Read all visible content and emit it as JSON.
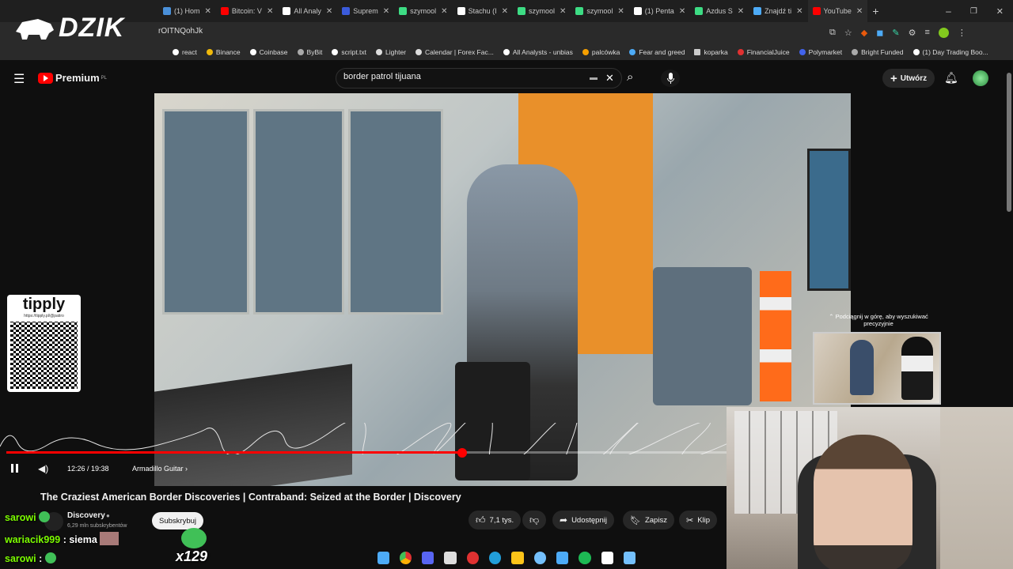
{
  "browser": {
    "tabs": [
      {
        "label": "(1) Hom",
        "color": "#4a90d9"
      },
      {
        "label": "Bitcoin: V",
        "color": "#ff0000"
      },
      {
        "label": "All Analy",
        "color": "#ffffff"
      },
      {
        "label": "Suprem",
        "color": "#3b5bdb"
      },
      {
        "label": "szymool",
        "color": "#3ddc84"
      },
      {
        "label": "Stachu (I",
        "color": "#ffffff"
      },
      {
        "label": "szymool",
        "color": "#3ddc84"
      },
      {
        "label": "szymool",
        "color": "#3ddc84"
      },
      {
        "label": "(1) Penta",
        "color": "#ffffff"
      },
      {
        "label": "Azdus S",
        "color": "#3ddc84"
      },
      {
        "label": "Znajdź ti",
        "color": "#4dabf7"
      },
      {
        "label": "YouTube",
        "color": "#ff0000"
      }
    ],
    "url_fragment": "rOITNQohJk",
    "bookmarks": [
      "react",
      "Binance",
      "Coinbase",
      "ByBit",
      "script.txt",
      "Lighter",
      "Calendar | Forex Fac...",
      "All Analysts - unbias",
      "palcówka",
      "Fear and greed",
      "koparka",
      "FinancialJuice",
      "Polymarket",
      "Bright Funded",
      "(1) Day Trading Boo..."
    ],
    "overlay_logo": "DZIK"
  },
  "youtube": {
    "logo": "Premium",
    "logo_sup": "PL",
    "search_value": "border patrol tijuana",
    "create_label": "Utwórz",
    "video": {
      "time": "12:26 / 19:38",
      "chapter": "Armadillo Guitar",
      "progress_pct": 63.3,
      "title": "The Craziest American Border Discoveries | Contraband: Seized at the Border | Discovery"
    },
    "channel": {
      "name": "Discovery",
      "subs": "6,29 mln subskrybentów",
      "subscribe": "Subskrybuj"
    },
    "actions": {
      "likes": "7,1 tys.",
      "share": "Udostępnij",
      "save": "Zapisz",
      "clip": "Klip"
    },
    "miniplayer_hint": "Podciągnij w górę, aby wyszukiwać precyzyjnie"
  },
  "stream_overlay": {
    "tipply_label": "tipply",
    "tipply_url": "https://tipply.pl/@patiro",
    "chat": [
      {
        "user": "sarowi",
        "msg": ""
      },
      {
        "user": "wariacik999",
        "msg": ": siema"
      },
      {
        "user": "sarowi",
        "msg": ":"
      }
    ],
    "emote_count": "x129"
  }
}
